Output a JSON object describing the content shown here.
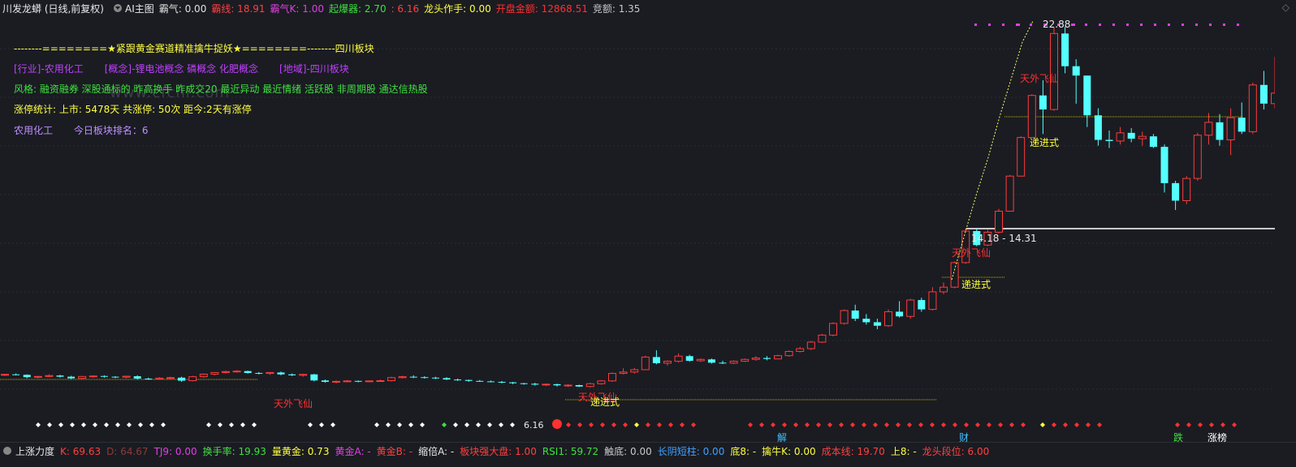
{
  "header": {
    "title": "川发龙蟒 (日线,前复权)",
    "ai_label": "AI主图",
    "indicators": [
      {
        "text": "霸气: 0.00",
        "color": "#e0e0e0"
      },
      {
        "text": "霸线: 18.91",
        "color": "#ff4040"
      },
      {
        "text": "霸气K: 1.00",
        "color": "#e040e0"
      },
      {
        "text": "起爆器: 2.70",
        "color": "#40e040"
      },
      {
        "text": ": 6.16",
        "color": "#ff4040"
      },
      {
        "text": "龙头作手: 0.00",
        "color": "#ffff40"
      },
      {
        "text": "开盘金额: 12868.51",
        "color": "#ff3030"
      },
      {
        "text": "竞额: 1.35",
        "color": "#c8c8c8"
      }
    ]
  },
  "info_panel": {
    "banner": "--------========★紧跟黄金赛道精准擒牛捉妖★========--------四川板块",
    "tags_row": [
      {
        "text": "[行业]-农用化工",
        "color": "#c040ff"
      },
      {
        "text": "[概念]-锂电池概念 磷概念 化肥概念",
        "color": "#c040ff"
      },
      {
        "text": "[地域]-四川板块",
        "color": "#c040ff"
      }
    ],
    "style_row": "风格: 融资融券  深股通标的  昨高换手  昨成交20  最近异动  最近情绪  活跃股  非周期股  通达信热股",
    "stats_row": "涨停统计:    上市: 5478天    共涨停: 50次    距今:2天有涨停",
    "sector_name": "农用化工",
    "sector_rank": "今日板块排名：6"
  },
  "watermark": "www.cfchi.com",
  "chart_labels": {
    "high_label": "22.88",
    "range_label": "14.18 - 14.31",
    "low_tag": "6.16",
    "signals": [
      "天外飞仙",
      "天外飞仙",
      "递进式",
      "天外飞仙",
      "递进式",
      "天外飞仙",
      "递进式"
    ],
    "bottom_tags": [
      "解",
      "财",
      "跌",
      "涨榜"
    ]
  },
  "chart_data": {
    "type": "candlestick",
    "candles": [
      [
        8.0,
        8.04,
        7.95,
        8.02
      ],
      [
        8.02,
        8.06,
        7.98,
        8.0
      ],
      [
        8.0,
        8.02,
        7.85,
        7.9
      ],
      [
        7.9,
        7.96,
        7.85,
        7.93
      ],
      [
        7.93,
        8.02,
        7.9,
        7.97
      ],
      [
        7.97,
        8.0,
        7.88,
        7.92
      ],
      [
        7.92,
        7.96,
        7.82,
        7.85
      ],
      [
        7.85,
        7.95,
        7.82,
        7.93
      ],
      [
        7.93,
        7.98,
        7.88,
        7.95
      ],
      [
        7.95,
        7.98,
        7.88,
        7.92
      ],
      [
        7.92,
        7.94,
        7.86,
        7.9
      ],
      [
        7.9,
        7.96,
        7.85,
        7.94
      ],
      [
        7.94,
        7.98,
        7.8,
        7.84
      ],
      [
        7.84,
        7.88,
        7.78,
        7.82
      ],
      [
        7.82,
        7.9,
        7.78,
        7.86
      ],
      [
        7.86,
        7.92,
        7.82,
        7.88
      ],
      [
        7.88,
        7.92,
        7.7,
        7.75
      ],
      [
        7.75,
        7.96,
        7.72,
        7.92
      ],
      [
        7.92,
        8.06,
        7.88,
        8.03
      ],
      [
        8.03,
        8.12,
        7.98,
        8.1
      ],
      [
        8.1,
        8.18,
        8.05,
        8.14
      ],
      [
        8.14,
        8.2,
        8.1,
        8.16
      ],
      [
        8.16,
        8.18,
        8.05,
        8.08
      ],
      [
        8.08,
        8.12,
        8.02,
        8.06
      ],
      [
        8.06,
        8.12,
        8.0,
        8.1
      ],
      [
        8.1,
        8.14,
        7.98,
        8.02
      ],
      [
        8.02,
        8.06,
        7.95,
        7.98
      ],
      [
        7.98,
        8.04,
        7.92,
        8.02
      ],
      [
        8.02,
        8.04,
        7.72,
        7.76
      ],
      [
        7.76,
        7.8,
        7.66,
        7.7
      ],
      [
        7.7,
        7.76,
        7.64,
        7.72
      ],
      [
        7.72,
        7.78,
        7.68,
        7.74
      ],
      [
        7.74,
        7.76,
        7.68,
        7.72
      ],
      [
        7.72,
        7.76,
        7.7,
        7.74
      ],
      [
        7.74,
        7.8,
        7.7,
        7.75
      ],
      [
        7.75,
        7.92,
        7.72,
        7.88
      ],
      [
        7.88,
        7.96,
        7.84,
        7.92
      ],
      [
        7.92,
        7.98,
        7.86,
        7.9
      ],
      [
        7.9,
        7.94,
        7.84,
        7.88
      ],
      [
        7.88,
        7.92,
        7.82,
        7.86
      ],
      [
        7.86,
        7.9,
        7.78,
        7.8
      ],
      [
        7.8,
        7.84,
        7.74,
        7.78
      ],
      [
        7.78,
        7.8,
        7.7,
        7.74
      ],
      [
        7.74,
        7.78,
        7.7,
        7.72
      ],
      [
        7.72,
        7.76,
        7.68,
        7.7
      ],
      [
        7.7,
        7.74,
        7.64,
        7.68
      ],
      [
        7.68,
        7.7,
        7.6,
        7.64
      ],
      [
        7.64,
        7.66,
        7.58,
        7.62
      ],
      [
        7.62,
        7.66,
        7.54,
        7.58
      ],
      [
        7.58,
        7.62,
        7.52,
        7.6
      ],
      [
        7.6,
        7.62,
        7.5,
        7.55
      ],
      [
        7.55,
        7.6,
        7.48,
        7.56
      ],
      [
        7.56,
        7.58,
        7.48,
        7.5
      ],
      [
        7.5,
        7.66,
        7.46,
        7.62
      ],
      [
        7.62,
        7.78,
        7.58,
        7.74
      ],
      [
        7.74,
        8.1,
        7.7,
        8.06
      ],
      [
        8.06,
        8.28,
        8.02,
        8.12
      ],
      [
        8.12,
        8.3,
        8.05,
        8.22
      ],
      [
        8.22,
        8.82,
        8.2,
        8.76
      ],
      [
        8.76,
        9.05,
        8.45,
        8.5
      ],
      [
        8.5,
        8.62,
        8.4,
        8.58
      ],
      [
        8.58,
        8.92,
        8.52,
        8.8
      ],
      [
        8.8,
        8.86,
        8.56,
        8.6
      ],
      [
        8.6,
        8.7,
        8.55,
        8.66
      ],
      [
        8.66,
        8.7,
        8.48,
        8.52
      ],
      [
        8.52,
        8.6,
        8.46,
        8.5
      ],
      [
        8.5,
        8.62,
        8.46,
        8.58
      ],
      [
        8.58,
        8.7,
        8.55,
        8.66
      ],
      [
        8.66,
        8.8,
        8.6,
        8.72
      ],
      [
        8.72,
        8.8,
        8.62,
        8.68
      ],
      [
        8.68,
        8.86,
        8.66,
        8.82
      ],
      [
        8.82,
        9.04,
        8.78,
        9.0
      ],
      [
        9.0,
        9.2,
        8.96,
        9.12
      ],
      [
        9.12,
        9.45,
        9.06,
        9.4
      ],
      [
        9.4,
        9.75,
        9.36,
        9.7
      ],
      [
        9.7,
        10.25,
        9.65,
        10.2
      ],
      [
        10.2,
        10.8,
        10.15,
        10.75
      ],
      [
        10.75,
        11.0,
        10.3,
        10.4
      ],
      [
        10.4,
        10.6,
        10.15,
        10.25
      ],
      [
        10.25,
        10.4,
        9.95,
        10.1
      ],
      [
        10.1,
        10.8,
        10.05,
        10.7
      ],
      [
        10.7,
        11.15,
        10.45,
        10.5
      ],
      [
        10.5,
        11.25,
        10.4,
        11.2
      ],
      [
        11.2,
        11.3,
        10.7,
        10.8
      ],
      [
        10.8,
        11.75,
        10.75,
        11.55
      ],
      [
        11.55,
        11.95,
        11.45,
        11.75
      ],
      [
        11.75,
        12.85,
        11.7,
        12.8
      ],
      [
        12.8,
        14.25,
        12.75,
        14.15
      ],
      [
        14.15,
        14.28,
        13.5,
        13.55
      ],
      [
        13.55,
        14.2,
        13.5,
        14.1
      ],
      [
        14.1,
        15.1,
        14.05,
        15.0
      ],
      [
        15.0,
        16.55,
        15.0,
        16.5
      ],
      [
        16.5,
        18.2,
        16.5,
        18.15
      ],
      [
        18.15,
        20.0,
        18.15,
        19.95
      ],
      [
        19.95,
        20.6,
        18.3,
        19.35
      ],
      [
        19.35,
        22.88,
        19.3,
        22.6
      ],
      [
        22.6,
        22.88,
        20.9,
        21.2
      ],
      [
        21.2,
        21.5,
        19.6,
        20.8
      ],
      [
        20.8,
        20.8,
        18.6,
        19.1
      ],
      [
        19.1,
        19.4,
        17.8,
        18.05
      ],
      [
        18.05,
        18.45,
        17.7,
        18.0
      ],
      [
        18.0,
        18.6,
        17.85,
        18.35
      ],
      [
        18.35,
        18.55,
        17.95,
        18.1
      ],
      [
        18.1,
        18.4,
        17.8,
        18.2
      ],
      [
        18.2,
        18.3,
        17.7,
        17.75
      ],
      [
        17.75,
        17.85,
        15.8,
        16.2
      ],
      [
        16.2,
        16.3,
        15.05,
        15.45
      ],
      [
        15.45,
        16.5,
        15.3,
        16.4
      ],
      [
        16.4,
        18.35,
        16.3,
        18.25
      ],
      [
        18.25,
        19.2,
        17.85,
        18.8
      ],
      [
        18.8,
        19.15,
        17.8,
        18.05
      ],
      [
        18.05,
        19.4,
        17.4,
        19.0
      ],
      [
        19.0,
        19.65,
        18.3,
        18.4
      ],
      [
        18.4,
        20.5,
        18.3,
        20.4
      ],
      [
        20.4,
        21.0,
        19.35,
        19.6
      ],
      [
        19.6,
        21.6,
        19.4,
        20.05
      ]
    ],
    "high_price": 22.88,
    "low_price": 6.16
  }
}
